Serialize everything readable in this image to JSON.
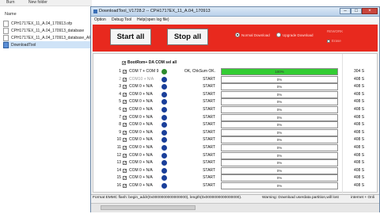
{
  "explorer": {
    "menu": [
      "Burn",
      "New folder"
    ],
    "header": "Name",
    "files": [
      {
        "name": "CPH1717EX_11_A.04_170913.ofp",
        "selected": false
      },
      {
        "name": "CPH1717EX_11_A.04_170913_database",
        "selected": false
      },
      {
        "name": "CPH1717EX_11_A.04_170913_database_AP",
        "selected": false
      },
      {
        "name": "DownloadTool",
        "selected": true
      }
    ]
  },
  "window": {
    "title": "DownloadTool_V1728.2 -- CPH1717EX_11_A.04_170913",
    "controls": {
      "minimize": "–",
      "maximize": "□",
      "close": "×"
    },
    "menu": [
      "Option",
      "Debug Tool",
      "Help(open log file)"
    ]
  },
  "toolbar": {
    "start_all": "Start all",
    "stop_all": "Stop all",
    "radio_1": "Normal Download",
    "radio_2": "Upgrade Download",
    "faint_label": "REWORK",
    "faint_check": "Erase"
  },
  "all_ports_label": "BootRom+ DA COM sel all",
  "rows": [
    {
      "num": "1",
      "checked": true,
      "port": "COM 7 + COM 9",
      "led": "ok",
      "status": "OK, ChkSum OK.",
      "percent": "100%",
      "progress": 100,
      "time": "304 S"
    },
    {
      "num": "2",
      "checked": true,
      "port": "COM10 + N/A",
      "led": "blue",
      "status": "START",
      "percent": "0%",
      "progress": 0,
      "time": "408 S",
      "disabled": true
    },
    {
      "num": "3",
      "checked": true,
      "port": "COM 0 + N/A",
      "led": "blue",
      "status": "START",
      "percent": "0%",
      "progress": 0,
      "time": "408 S"
    },
    {
      "num": "4",
      "checked": true,
      "port": "COM 0 + N/A",
      "led": "blue",
      "status": "START",
      "percent": "0%",
      "progress": 0,
      "time": "408 S"
    },
    {
      "num": "5",
      "checked": true,
      "port": "COM 0 + N/A",
      "led": "blue",
      "status": "START",
      "percent": "0%",
      "progress": 0,
      "time": "408 S"
    },
    {
      "num": "6",
      "checked": true,
      "port": "COM 0 + N/A",
      "led": "blue",
      "status": "START",
      "percent": "0%",
      "progress": 0,
      "time": "408 S"
    },
    {
      "num": "7",
      "checked": true,
      "port": "COM 0 + N/A",
      "led": "blue",
      "status": "START",
      "percent": "0%",
      "progress": 0,
      "time": "408 S"
    },
    {
      "num": "8",
      "checked": true,
      "port": "COM 0 + N/A",
      "led": "blue",
      "status": "START",
      "percent": "0%",
      "progress": 0,
      "time": "408 S"
    },
    {
      "num": "9",
      "checked": true,
      "port": "COM 0 + N/A",
      "led": "blue",
      "status": "START",
      "percent": "0%",
      "progress": 0,
      "time": "408 S"
    },
    {
      "num": "10",
      "checked": true,
      "port": "COM 0 + N/A",
      "led": "blue",
      "status": "START",
      "percent": "0%",
      "progress": 0,
      "time": "408 S"
    },
    {
      "num": "11",
      "checked": true,
      "port": "COM 0 + N/A",
      "led": "blue",
      "status": "START",
      "percent": "0%",
      "progress": 0,
      "time": "408 S"
    },
    {
      "num": "12",
      "checked": true,
      "port": "COM 0 + N/A",
      "led": "blue",
      "status": "START",
      "percent": "0%",
      "progress": 0,
      "time": "408 S"
    },
    {
      "num": "13",
      "checked": true,
      "port": "COM 0 + N/A",
      "led": "blue",
      "status": "START",
      "percent": "0%",
      "progress": 0,
      "time": "408 S"
    },
    {
      "num": "14",
      "checked": true,
      "port": "COM 0 + N/A",
      "led": "blue",
      "status": "START",
      "percent": "0%",
      "progress": 0,
      "time": "408 S"
    },
    {
      "num": "15",
      "checked": true,
      "port": "COM 0 + N/A",
      "led": "blue",
      "status": "START",
      "percent": "0%",
      "progress": 0,
      "time": "408 S"
    },
    {
      "num": "16",
      "checked": true,
      "port": "COM 0 + N/A",
      "led": "blue",
      "status": "START",
      "percent": "0%",
      "progress": 0,
      "time": "408 S"
    }
  ],
  "statusbar": {
    "left": "Format EMMC flash:  begin_addr(0x0000000000000000), length(0x0000000000000000).",
    "middle": "Warning: Download userdata partition,will lost",
    "right": "internet + Onli"
  },
  "colors": {
    "red_panel": "#e8291e",
    "progress_green": "#33cc33",
    "led_blue": "#1a3f9a",
    "led_green": "#2e8b2e"
  }
}
